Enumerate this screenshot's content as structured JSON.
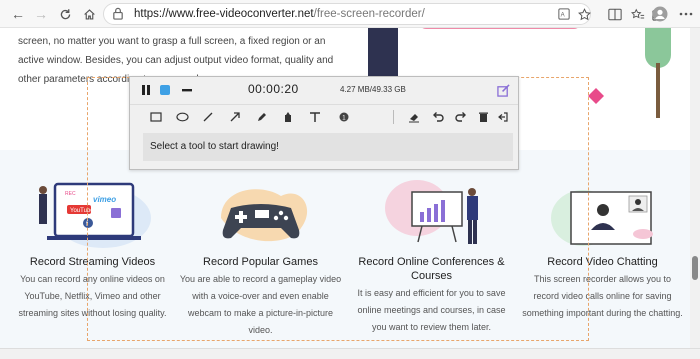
{
  "browser": {
    "url_domain": "https://www.free-videoconverter.net",
    "url_path": "/free-screen-recorder/"
  },
  "intro": {
    "text": "screen, no matter you want to grasp a full screen, a fixed region or an active window. Besides, you can adjust output video format, quality and other parameters according to your need."
  },
  "recorder": {
    "timer": "00:00:20",
    "file_size": "4.27 MB/49.33 GB",
    "hint": "Select a tool to start drawing!"
  },
  "features": [
    {
      "title": "Record Streaming Videos",
      "desc": "You can record any online videos on YouTube, Netflix, Vimeo and other streaming sites without losing quality.",
      "art_labels": [
        "REC",
        "vimeo",
        "YouTube",
        "f"
      ]
    },
    {
      "title": "Record Popular Games",
      "desc": "You are able to record a gameplay video with a voice-over and even enable webcam to make a picture-in-picture video."
    },
    {
      "title": "Record Online Conferences & Courses",
      "desc": "It is easy and efficient for you to save online meetings and courses, in case you want to review them later."
    },
    {
      "title": "Record Video Chatting",
      "desc": "This screen recorder allows you to record video calls online for saving something important during the chatting."
    }
  ],
  "colors": {
    "accent_blue": "#3ea0e5",
    "purple": "#8a6fd6",
    "pink": "#e84b8a",
    "region_border": "#e8a56b"
  }
}
